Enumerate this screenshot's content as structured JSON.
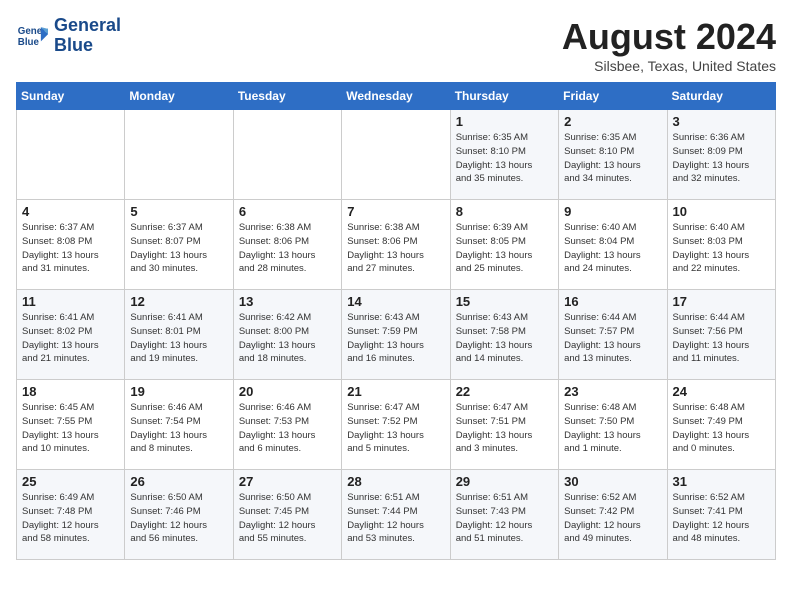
{
  "logo": {
    "line1": "General",
    "line2": "Blue"
  },
  "title": "August 2024",
  "location": "Silsbee, Texas, United States",
  "days_of_week": [
    "Sunday",
    "Monday",
    "Tuesday",
    "Wednesday",
    "Thursday",
    "Friday",
    "Saturday"
  ],
  "weeks": [
    [
      {
        "day": "",
        "info": ""
      },
      {
        "day": "",
        "info": ""
      },
      {
        "day": "",
        "info": ""
      },
      {
        "day": "",
        "info": ""
      },
      {
        "day": "1",
        "info": "Sunrise: 6:35 AM\nSunset: 8:10 PM\nDaylight: 13 hours\nand 35 minutes."
      },
      {
        "day": "2",
        "info": "Sunrise: 6:35 AM\nSunset: 8:10 PM\nDaylight: 13 hours\nand 34 minutes."
      },
      {
        "day": "3",
        "info": "Sunrise: 6:36 AM\nSunset: 8:09 PM\nDaylight: 13 hours\nand 32 minutes."
      }
    ],
    [
      {
        "day": "4",
        "info": "Sunrise: 6:37 AM\nSunset: 8:08 PM\nDaylight: 13 hours\nand 31 minutes."
      },
      {
        "day": "5",
        "info": "Sunrise: 6:37 AM\nSunset: 8:07 PM\nDaylight: 13 hours\nand 30 minutes."
      },
      {
        "day": "6",
        "info": "Sunrise: 6:38 AM\nSunset: 8:06 PM\nDaylight: 13 hours\nand 28 minutes."
      },
      {
        "day": "7",
        "info": "Sunrise: 6:38 AM\nSunset: 8:06 PM\nDaylight: 13 hours\nand 27 minutes."
      },
      {
        "day": "8",
        "info": "Sunrise: 6:39 AM\nSunset: 8:05 PM\nDaylight: 13 hours\nand 25 minutes."
      },
      {
        "day": "9",
        "info": "Sunrise: 6:40 AM\nSunset: 8:04 PM\nDaylight: 13 hours\nand 24 minutes."
      },
      {
        "day": "10",
        "info": "Sunrise: 6:40 AM\nSunset: 8:03 PM\nDaylight: 13 hours\nand 22 minutes."
      }
    ],
    [
      {
        "day": "11",
        "info": "Sunrise: 6:41 AM\nSunset: 8:02 PM\nDaylight: 13 hours\nand 21 minutes."
      },
      {
        "day": "12",
        "info": "Sunrise: 6:41 AM\nSunset: 8:01 PM\nDaylight: 13 hours\nand 19 minutes."
      },
      {
        "day": "13",
        "info": "Sunrise: 6:42 AM\nSunset: 8:00 PM\nDaylight: 13 hours\nand 18 minutes."
      },
      {
        "day": "14",
        "info": "Sunrise: 6:43 AM\nSunset: 7:59 PM\nDaylight: 13 hours\nand 16 minutes."
      },
      {
        "day": "15",
        "info": "Sunrise: 6:43 AM\nSunset: 7:58 PM\nDaylight: 13 hours\nand 14 minutes."
      },
      {
        "day": "16",
        "info": "Sunrise: 6:44 AM\nSunset: 7:57 PM\nDaylight: 13 hours\nand 13 minutes."
      },
      {
        "day": "17",
        "info": "Sunrise: 6:44 AM\nSunset: 7:56 PM\nDaylight: 13 hours\nand 11 minutes."
      }
    ],
    [
      {
        "day": "18",
        "info": "Sunrise: 6:45 AM\nSunset: 7:55 PM\nDaylight: 13 hours\nand 10 minutes."
      },
      {
        "day": "19",
        "info": "Sunrise: 6:46 AM\nSunset: 7:54 PM\nDaylight: 13 hours\nand 8 minutes."
      },
      {
        "day": "20",
        "info": "Sunrise: 6:46 AM\nSunset: 7:53 PM\nDaylight: 13 hours\nand 6 minutes."
      },
      {
        "day": "21",
        "info": "Sunrise: 6:47 AM\nSunset: 7:52 PM\nDaylight: 13 hours\nand 5 minutes."
      },
      {
        "day": "22",
        "info": "Sunrise: 6:47 AM\nSunset: 7:51 PM\nDaylight: 13 hours\nand 3 minutes."
      },
      {
        "day": "23",
        "info": "Sunrise: 6:48 AM\nSunset: 7:50 PM\nDaylight: 13 hours\nand 1 minute."
      },
      {
        "day": "24",
        "info": "Sunrise: 6:48 AM\nSunset: 7:49 PM\nDaylight: 13 hours\nand 0 minutes."
      }
    ],
    [
      {
        "day": "25",
        "info": "Sunrise: 6:49 AM\nSunset: 7:48 PM\nDaylight: 12 hours\nand 58 minutes."
      },
      {
        "day": "26",
        "info": "Sunrise: 6:50 AM\nSunset: 7:46 PM\nDaylight: 12 hours\nand 56 minutes."
      },
      {
        "day": "27",
        "info": "Sunrise: 6:50 AM\nSunset: 7:45 PM\nDaylight: 12 hours\nand 55 minutes."
      },
      {
        "day": "28",
        "info": "Sunrise: 6:51 AM\nSunset: 7:44 PM\nDaylight: 12 hours\nand 53 minutes."
      },
      {
        "day": "29",
        "info": "Sunrise: 6:51 AM\nSunset: 7:43 PM\nDaylight: 12 hours\nand 51 minutes."
      },
      {
        "day": "30",
        "info": "Sunrise: 6:52 AM\nSunset: 7:42 PM\nDaylight: 12 hours\nand 49 minutes."
      },
      {
        "day": "31",
        "info": "Sunrise: 6:52 AM\nSunset: 7:41 PM\nDaylight: 12 hours\nand 48 minutes."
      }
    ]
  ]
}
